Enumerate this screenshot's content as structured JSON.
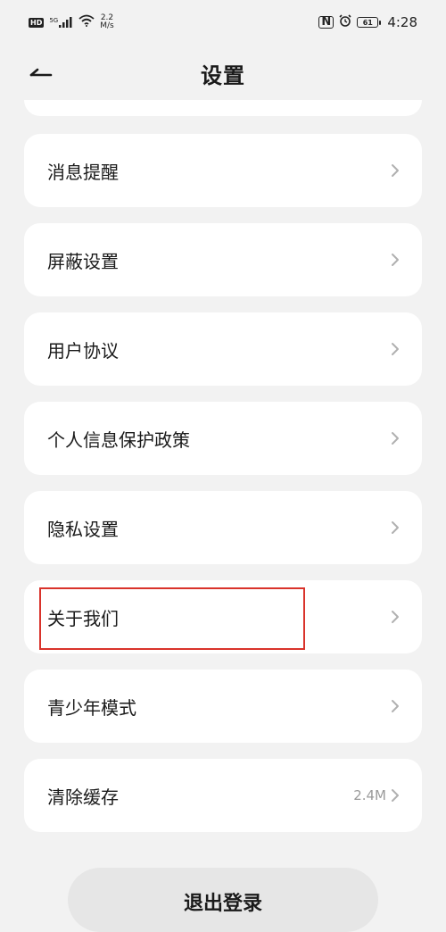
{
  "status_bar": {
    "hd_badge": "HD",
    "network": "5G",
    "speed_value": "2.2",
    "speed_unit": "M/s",
    "nfc": "N",
    "battery": "61",
    "time": "4:28"
  },
  "header": {
    "title": "设置"
  },
  "menu": {
    "items": [
      {
        "label": "消息提醒",
        "value": ""
      },
      {
        "label": "屏蔽设置",
        "value": ""
      },
      {
        "label": "用户协议",
        "value": ""
      },
      {
        "label": "个人信息保护政策",
        "value": ""
      },
      {
        "label": "隐私设置",
        "value": ""
      },
      {
        "label": "关于我们",
        "value": ""
      },
      {
        "label": "青少年模式",
        "value": ""
      },
      {
        "label": "清除缓存",
        "value": "2.4M"
      }
    ]
  },
  "logout": {
    "label": "退出登录"
  },
  "colors": {
    "background": "#f2f2f2",
    "card": "#ffffff",
    "highlight": "#d9332b",
    "logout_bg": "#e6e6e6"
  }
}
